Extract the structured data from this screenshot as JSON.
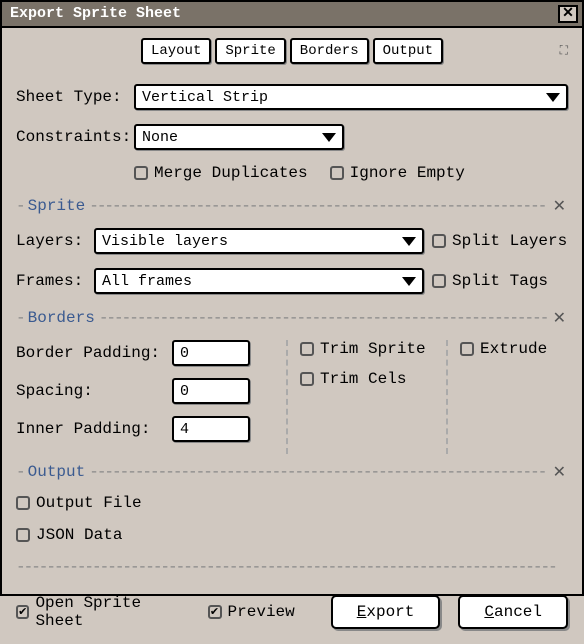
{
  "title": "Export Sprite Sheet",
  "tabs": {
    "layout": "Layout",
    "sprite": "Sprite",
    "borders": "Borders",
    "output": "Output"
  },
  "sheet_type": {
    "label": "Sheet Type:",
    "value": "Vertical Strip"
  },
  "constraints": {
    "label": "Constraints:",
    "value": "None"
  },
  "merge_dup": "Merge Duplicates",
  "ignore_empty": "Ignore Empty",
  "sections": {
    "sprite": "Sprite",
    "borders": "Borders",
    "output": "Output"
  },
  "layers": {
    "label": "Layers:",
    "value": "Visible layers"
  },
  "frames": {
    "label": "Frames:",
    "value": "All frames"
  },
  "split_layers": "Split Layers",
  "split_tags": "Split Tags",
  "border_padding": {
    "label": "Border Padding:",
    "value": "0"
  },
  "spacing": {
    "label": "Spacing:",
    "value": "0"
  },
  "inner_padding": {
    "label": "Inner Padding:",
    "value": "4"
  },
  "trim_sprite": "Trim Sprite",
  "trim_cels": "Trim Cels",
  "extrude": "Extrude",
  "output_file": "Output File",
  "json_data": "JSON Data",
  "open_sheet": "Open Sprite Sheet",
  "preview": "Preview",
  "export_btn": "Export",
  "cancel_btn": "Cancel"
}
